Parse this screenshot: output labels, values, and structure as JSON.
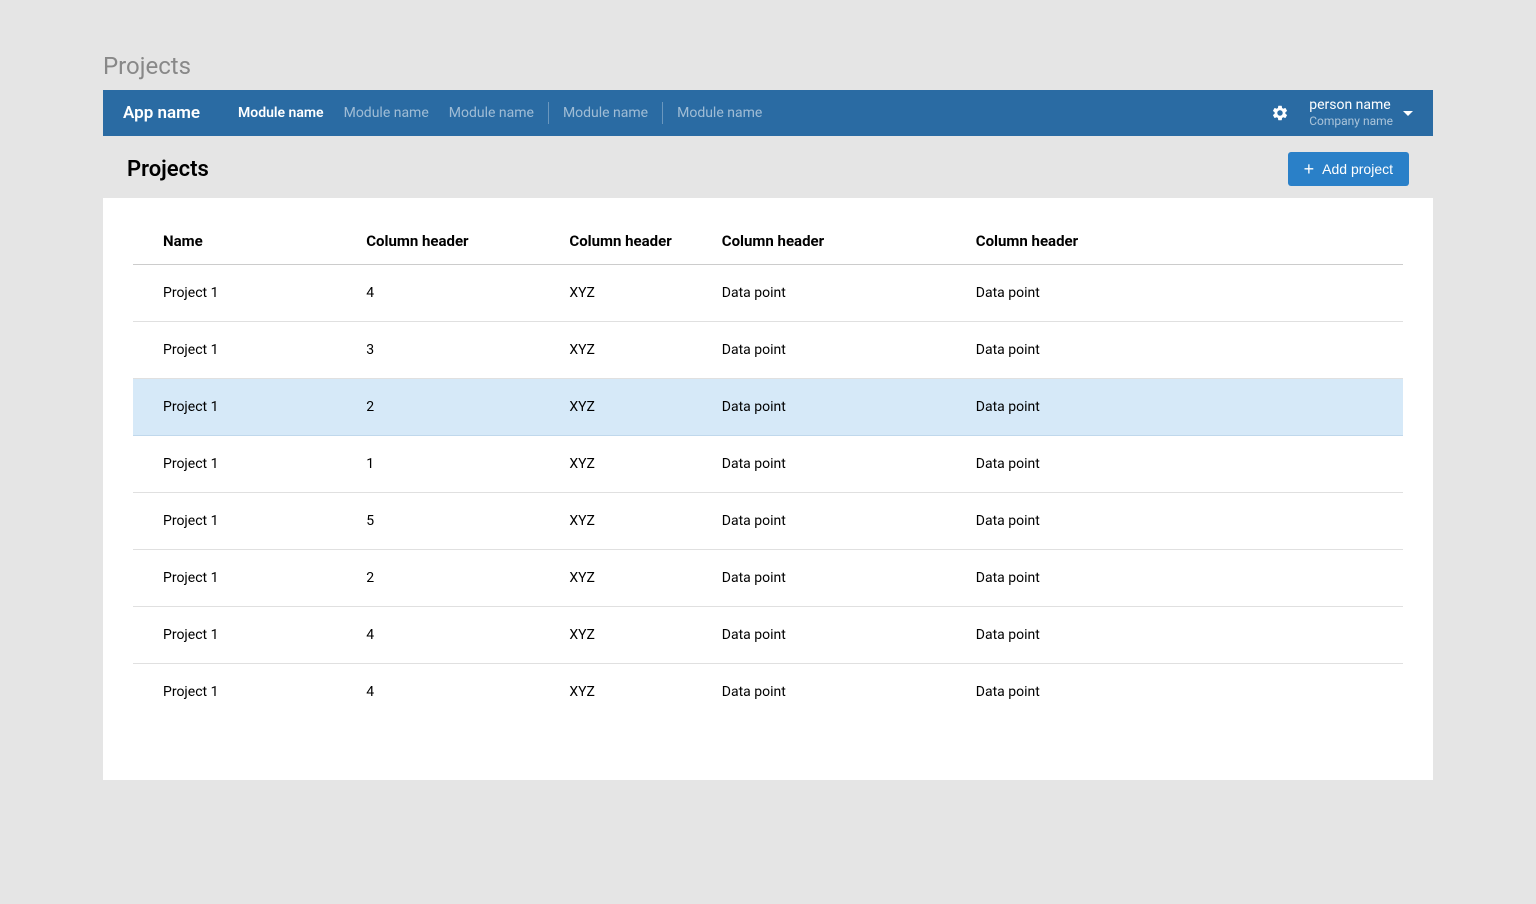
{
  "page_label": "Projects",
  "header": {
    "app_name": "App name",
    "modules": [
      {
        "label": "Module name",
        "active": true
      },
      {
        "label": "Module name",
        "active": false
      },
      {
        "label": "Module name",
        "active": false
      },
      {
        "divider": true
      },
      {
        "label": "Module name",
        "active": false
      },
      {
        "divider": true
      },
      {
        "label": "Module name",
        "active": false
      }
    ],
    "user": {
      "person_name": "person name",
      "company_name": "Company name"
    }
  },
  "sub_header": {
    "title": "Projects",
    "add_button_label": "Add project"
  },
  "table": {
    "columns": [
      "Name",
      "Column header",
      "Column header",
      "Column header",
      "Column header"
    ],
    "rows": [
      {
        "cells": [
          "Project 1",
          "4",
          "XYZ",
          "Data point",
          "Data point"
        ],
        "selected": false
      },
      {
        "cells": [
          "Project 1",
          "3",
          "XYZ",
          "Data point",
          "Data point"
        ],
        "selected": false
      },
      {
        "cells": [
          "Project 1",
          "2",
          "XYZ",
          "Data point",
          "Data point"
        ],
        "selected": true
      },
      {
        "cells": [
          "Project 1",
          "1",
          "XYZ",
          "Data point",
          "Data point"
        ],
        "selected": false
      },
      {
        "cells": [
          "Project 1",
          "5",
          "XYZ",
          "Data point",
          "Data point"
        ],
        "selected": false
      },
      {
        "cells": [
          "Project 1",
          "2",
          "XYZ",
          "Data point",
          "Data point"
        ],
        "selected": false
      },
      {
        "cells": [
          "Project 1",
          "4",
          "XYZ",
          "Data point",
          "Data point"
        ],
        "selected": false
      },
      {
        "cells": [
          "Project 1",
          "4",
          "XYZ",
          "Data point",
          "Data point"
        ],
        "selected": false
      }
    ]
  }
}
